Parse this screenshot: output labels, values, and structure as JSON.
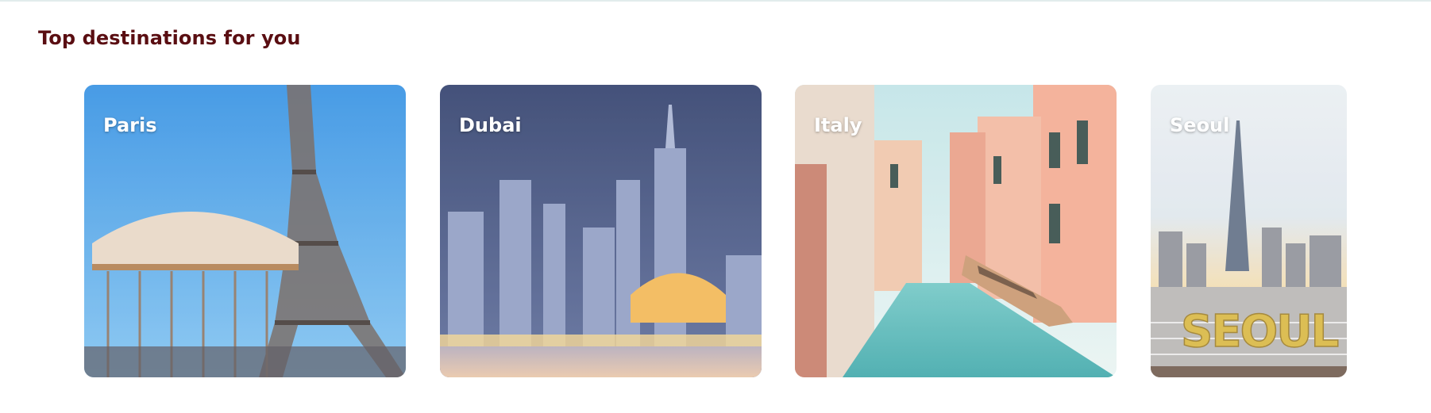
{
  "section": {
    "title": "Top destinations for you"
  },
  "destinations": [
    {
      "name": "Paris"
    },
    {
      "name": "Dubai"
    },
    {
      "name": "Italy"
    },
    {
      "name": "Seoul"
    }
  ],
  "colors": {
    "title": "#5a0e12",
    "card_label": "#ffffff"
  }
}
